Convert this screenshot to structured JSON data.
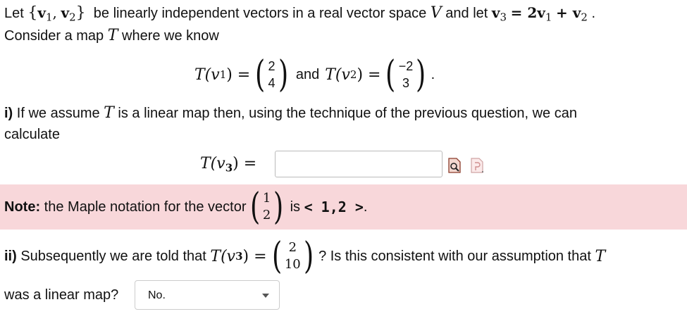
{
  "intro": {
    "let": "Let",
    "set_open": "{",
    "v1": "v",
    "v1_sub": "1",
    "comma": ",",
    "v2": "v",
    "v2_sub": "2",
    "set_close": "}",
    "text1": "be linearly independent vectors in a real vector space",
    "V": "V",
    "text2": "and let",
    "v3": "v",
    "v3_sub": "3",
    "eq_rhs": "= 2v",
    "rhs_sub1": "1",
    "plus": "+ v",
    "rhs_sub2": "2",
    "period": ".",
    "line2_a": "Consider a map",
    "T": "T",
    "line2_b": "where we know"
  },
  "given": {
    "Tv1_lhs": "T(v",
    "Tv1_sub": "1",
    "Tv1_rhs": ") =",
    "Tv1_vec": [
      "2",
      "4"
    ],
    "and": "and",
    "Tv2_lhs": "T(v",
    "Tv2_sub": "2",
    "Tv2_rhs": ") =",
    "Tv2_vec": [
      "−2",
      "3"
    ],
    "period": "."
  },
  "part_i": {
    "label": "i)",
    "text_a": "If we assume",
    "T": "T",
    "text_b": "is a linear map then, using the technique of the previous question, we can",
    "text_c": "calculate",
    "Tv3_lhs": "T(v",
    "Tv3_sub": "3",
    "Tv3_rhs": ") =",
    "answer_value": ""
  },
  "note": {
    "label": "Note:",
    "text_a": "the Maple notation for the vector",
    "vec": [
      "1",
      "2"
    ],
    "text_b": "is",
    "maple": "< 1,2 >",
    "period": "."
  },
  "part_ii": {
    "label": "ii)",
    "text_a": "Subsequently we are told that",
    "Tv3_lhs": "T(v",
    "Tv3_sub": "3",
    "Tv3_rhs": ") =",
    "vec": [
      "2",
      "10"
    ],
    "text_b": "? Is this consistent with our assumption that",
    "T": "T",
    "text_c": "was a linear map?",
    "select_value": "No."
  },
  "icons": [
    "preview-icon",
    "help-icon"
  ]
}
